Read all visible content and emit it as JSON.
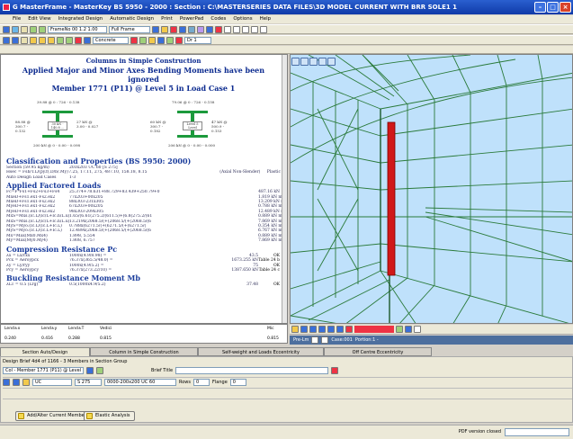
{
  "window": {
    "title": "G MasterFrame - MasterKey BS 5950 - 2000 : Section : C:\\MASTERSERIES DATA FILES\\3D MODEL CURRENT WITH BRR SOLE1 1"
  },
  "menu": [
    "File",
    "Edit View",
    "Integrated Design",
    "Automatic Design",
    "Print",
    "PowerPad",
    "Codes",
    "Options",
    "Help"
  ],
  "toolbar": {
    "combo1": "FrameNo 00 1.2 1.00",
    "combo2": "Full Frame",
    "combo3": "Concrete",
    "combo4": "Dr 1"
  },
  "doc": {
    "title1": "Columns in Simple Construction",
    "title2": "Applied Major and Minor Axes Bending Moments have been ignored",
    "title3": "Member 1771 (P11) @ Level 5 in Load Case 1",
    "sections": [
      {
        "top": "39.88 @ 0 : 726 - 0.138",
        "left": "88.88 @ 300.7 - 0.132",
        "right": "27 kN @ 3.00 - 0.027",
        "mid": "30 kN - 140.8 ...",
        "bot": "200 kN @ 0 - 0.00 - 0.098"
      },
      {
        "top": "79.06 @ 0 : 726 - 0.158",
        "left": "60 kN @ 300.7 - 0.182",
        "right": "47 kN @ 500.9 - 0.153",
        "mid": "Level 5 Level",
        "bot": "206 kN @ 0 - 0.00 - 0.000"
      }
    ],
    "classification": {
      "heading": "Classification and Properties (BS 5950: 2000)",
      "rows": [
        [
          "Section (59.95 kg/m)",
          "203x203 UC 60 [S 275]",
          ""
        ],
        [
          "Hsec = Fsb/T.L/(py.f(.D/b/.My)",
          "7.25, 17.11, 275, 487.10, 158.18, 8.15",
          "(Axial Non-Slender)"
        ],
        [
          "Auto Design Load Cases",
          "1-3",
          ""
        ]
      ],
      "plastic": "Plastic"
    },
    "loads": {
      "heading": "Applied Factored Loads",
      "rows": [
        [
          "Fc=F*Fs1+Fs2+Fs3+Fs4",
          "25.374+78.631+88.729+83.439+250.79+0",
          "487.16 kN"
        ],
        [
          "MxeD+Fs1.ex1-Fs2.ex2",
          "77x203+00x205",
          "1.819 kN m"
        ],
        [
          "MxeD+Fs1.ex1-Fs2.ex2",
          "88x303-231x305",
          "13.209 kN m"
        ],
        [
          "MyeD+Fs1.ex1-Fs2.ex2",
          "67x203+00x205",
          "0.788 kN m"
        ],
        [
          "MyeD+Fs1.ex1-Fs2.ex2",
          "98x303-209x305",
          "12.489 kN m"
        ],
        [
          "MxS=Mxs.(Ic.L/(Ic/L+Ic.n/L.u)",
          "1.65/(6.61(275.2/(611.5)+(6.8(275.2/(61",
          "0.889 kN m"
        ],
        [
          "MxS=Mxs.(Ic.L/(Ic/L+Ic.n/L.u)",
          "13.219x(2068.5/(+(2068.5/(+(2068.5/(6",
          "7.869 kN m"
        ],
        [
          "MyS=Myo.(Ic.L/(Ic.L+Ic.L)",
          "0.788x(6271.5/(+(6271.5/(+(6271.5/(",
          "0.354 kN m"
        ],
        [
          "MyS=Myo.(Ic.L/(Ic.L+Ic.L)",
          "12.489x(2068.5/(+(2068.5/(+(2068.5/(6",
          "6.767 kN m"
        ],
        [
          "Mx=Max(Mx0.Mx4)",
          "1.898, 5.554",
          "0.889 kN m"
        ],
        [
          "My=Max(My0.My4)",
          "1.808, 6.757",
          "7.869 kN m"
        ]
      ]
    },
    "compression": {
      "heading": "Compression Resistance Pc",
      "rows": [
        [
          "λx = Lx/rxx",
          "1000x(4.9/8.98) =",
          "43.5",
          "OK"
        ],
        [
          "Pcx = Aeroypcx",
          "76.37x(365.5/48.0) =",
          "1673.255 kN",
          "Table 24 b"
        ],
        [
          "λy = Ly/ryy",
          "1000x(4.9/5.2) =",
          "75",
          "OK"
        ],
        [
          "Pcy = Aeroypcy",
          "76.37x(273.22/10) =",
          "1387.650 kN",
          "Table 24 c"
        ]
      ]
    },
    "buckling": {
      "heading": "Buckling Resistance Moment Mb",
      "rows": [
        [
          "λLT = 0.5 (Lrg)",
          "0.5(1000x4.9/5.2)",
          "37.48",
          "OK"
        ]
      ]
    }
  },
  "mini": {
    "headers": [
      "Lend±x",
      "Lend±y",
      "Lend±T",
      "Vedici",
      "Mic"
    ],
    "values": [
      "0.240",
      "0.416",
      "0.288",
      "0.815",
      "0.815"
    ]
  },
  "viewtabs": {
    "zoom": "Pre-Lm",
    "case": "Case:001",
    "portion": "Portion:1 -"
  },
  "tabs": [
    "Section Auto/Design",
    "Column in Simple Construction",
    "Self-weight and Loads Eccentricity",
    "Off Centre Eccentricity"
  ],
  "panel": {
    "info": "Design Brief 4d4 of 1166 - 3 Members in Section Group",
    "member": "Col - Member 1771 (P11) @ Level 5",
    "brief_label": "Brief Title",
    "section": "UC",
    "grade": "S 275",
    "size": "0000-200x200 UC 60",
    "rows_label": "Rows",
    "rows_val": "0",
    "flange_label": "Flange",
    "flange_val": "0",
    "btn1": "Add/Alter Current Member",
    "btn2": "Elastic Analysis"
  },
  "status": {
    "text": "PDF version closed"
  }
}
